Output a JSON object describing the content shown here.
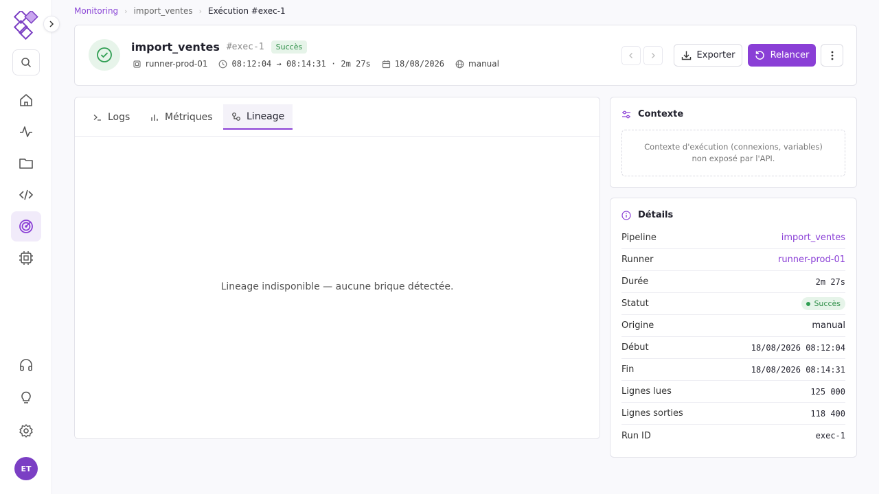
{
  "breadcrumb": {
    "root": "Monitoring",
    "pipeline": "import_ventes",
    "current": "Exécution #exec-1"
  },
  "header": {
    "title": "import_ventes",
    "exec_id": "#exec-1",
    "status": "Succès",
    "runner": "runner-prod-01",
    "time_range": "08:12:04 → 08:14:31 · 2m 27s",
    "date": "18/08/2026",
    "origin": "manual",
    "export_label": "Exporter",
    "relaunch_label": "Relancer"
  },
  "sidebar": {
    "avatar_initials": "ET",
    "active_item": "monitoring",
    "items": [
      "home",
      "activity",
      "folder",
      "code",
      "monitoring",
      "cpu"
    ],
    "bottom_items": [
      "support",
      "ideas",
      "settings"
    ]
  },
  "tabs": [
    {
      "label": "Logs",
      "icon": "terminal-icon"
    },
    {
      "label": "Métriques",
      "icon": "bar-chart-icon"
    },
    {
      "label": "Lineage",
      "icon": "lineage-icon",
      "active": true
    }
  ],
  "main": {
    "empty_message": "Lineage indisponible — aucune brique détectée."
  },
  "context": {
    "title": "Contexte",
    "message": "Contexte d'exécution (connexions, variables) non exposé par l'API."
  },
  "details": {
    "title": "Détails",
    "rows": [
      {
        "key": "Pipeline",
        "value": "import_ventes"
      },
      {
        "key": "Runner",
        "value": "runner-prod-01"
      },
      {
        "key": "Durée",
        "value": "2m 27s"
      },
      {
        "key": "Statut",
        "value": "Succès"
      },
      {
        "key": "Origine",
        "value": "manual"
      },
      {
        "key": "Début",
        "value": "18/08/2026 08:12:04"
      },
      {
        "key": "Fin",
        "value": "18/08/2026 08:14:31"
      },
      {
        "key": "Lignes lues",
        "value": "125 000"
      },
      {
        "key": "Lignes sorties",
        "value": "118 400"
      },
      {
        "key": "Run ID",
        "value": "exec-1"
      }
    ]
  },
  "colors": {
    "accent": "#8a3fd6",
    "success": "#2f8f48",
    "success_bg": "#e6f4e9"
  }
}
